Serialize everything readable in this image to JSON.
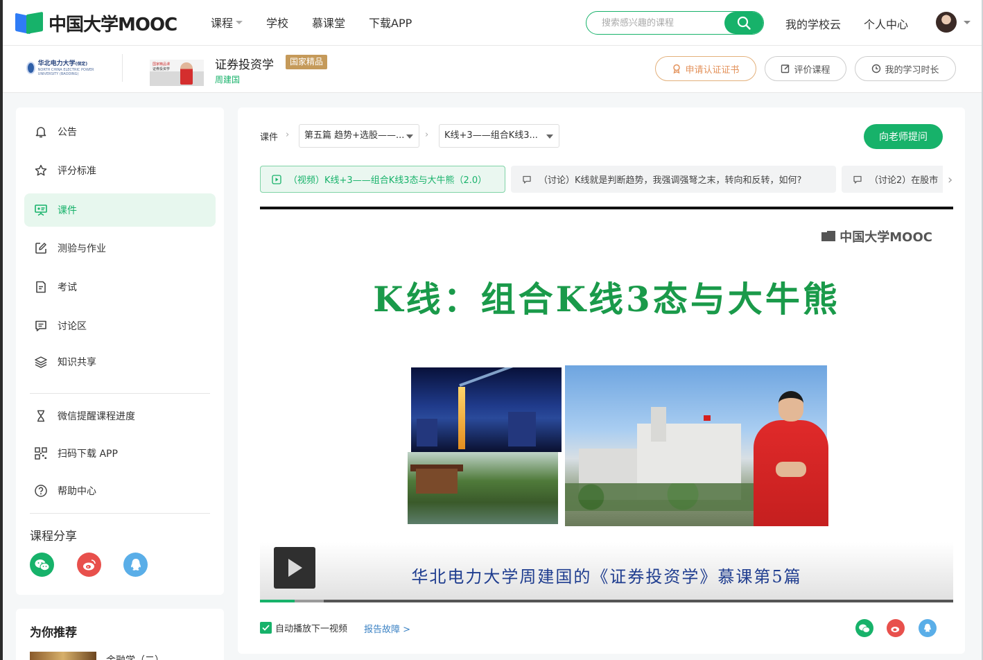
{
  "header": {
    "logo_text": "中国大学MOOC",
    "nav": [
      {
        "label": "课程",
        "has_caret": true
      },
      {
        "label": "学校",
        "has_caret": false
      },
      {
        "label": "慕课堂",
        "has_caret": false
      },
      {
        "label": "下载APP",
        "has_caret": false
      }
    ],
    "search_placeholder": "搜索感兴趣的课程",
    "school_cloud": "我的学校云",
    "personal_center": "个人中心"
  },
  "course": {
    "school_name": "华北电力大学",
    "school_name_suffix": "(保定)",
    "school_english": "NORTH CHINA ELECTRIC POWER UNIVERSITY (BAODING)",
    "thumb_line1": "国家精品课",
    "thumb_line2": "证券投资学",
    "title": "证券投资学",
    "badge": "国家精品",
    "teacher": "周建国",
    "buttons": {
      "certificate": "申请认证证书",
      "rate": "评价课程",
      "study_time": "我的学习时长"
    }
  },
  "sidebar": {
    "items": [
      {
        "label": "公告",
        "icon": "bell-icon",
        "active": false
      },
      {
        "label": "评分标准",
        "icon": "star-icon",
        "active": false
      },
      {
        "label": "课件",
        "icon": "courseware-icon",
        "active": true
      },
      {
        "label": "测验与作业",
        "icon": "edit-icon",
        "active": false
      },
      {
        "label": "考试",
        "icon": "exam-icon",
        "active": false
      },
      {
        "label": "讨论区",
        "icon": "discussion-icon",
        "active": false
      },
      {
        "label": "知识共享",
        "icon": "layers-icon",
        "active": false
      }
    ],
    "tools": [
      {
        "label": "微信提醒课程进度",
        "icon": "hourglass-icon"
      },
      {
        "label": "扫码下载 APP",
        "icon": "qrcode-icon"
      },
      {
        "label": "帮助中心",
        "icon": "help-icon"
      }
    ],
    "share_title": "课程分享",
    "share": [
      {
        "name": "wechat",
        "color": "#17b26a"
      },
      {
        "name": "weibo",
        "color": "#e8504c"
      },
      {
        "name": "qq",
        "color": "#5aaee8"
      }
    ]
  },
  "recommend": {
    "title": "为你推荐",
    "first_item": "金融学（二）"
  },
  "main": {
    "crumb_label": "课件",
    "chapter_select": "第五篇 趋势+选股——...",
    "lesson_select": "K线+3——组合K线3...",
    "ask_button": "向老师提问",
    "tabs": [
      {
        "label": "（视频）K线+3——组合K线3态与大牛熊（2.0）",
        "type": "video",
        "active": true
      },
      {
        "label": "（讨论）K线就是判断趋势，我强调强弩之末，转向和反转，如何?",
        "type": "discussion",
        "active": false
      },
      {
        "label": "（讨论2）在股市",
        "type": "discussion",
        "active": false
      }
    ],
    "video": {
      "watermark": "中国大学MOOC",
      "slide_title": "K线：组合K线3态与大牛熊",
      "slide_footer": "华北电力大学周建国的《证券投资学》慕课第5篇",
      "progress": 0.05,
      "buffered": 0.092
    },
    "autoplay_label": "自动播放下一视频",
    "autoplay_checked": true,
    "report_label": "报告故障 >"
  },
  "colors": {
    "brand_green": "#17b26a",
    "cert_orange": "#e3925b",
    "badge_gold": "#c59a5a",
    "weibo_red": "#e8504c",
    "qq_blue": "#5aaee8"
  }
}
